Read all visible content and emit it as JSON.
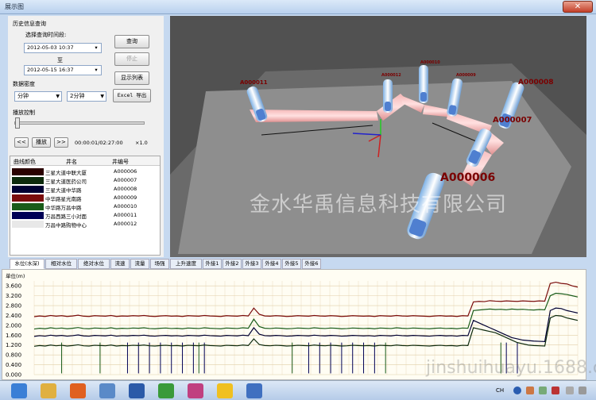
{
  "window": {
    "title": "展示图",
    "close": "✕"
  },
  "query": {
    "group_label": "历史信息查询",
    "time_range_label": "选择查询时间段:",
    "start": "2012-05-03 10:37",
    "to_label": "至",
    "end": "2012-05-15 16:37",
    "density_label": "数据密度",
    "density_unit": "分钟",
    "density_value": "2分钟",
    "query_button": "查询",
    "stop_button": "停止",
    "list_button": "显示列表",
    "excel_button": "Excel 导出"
  },
  "playback": {
    "label": "播放控制",
    "back_button": "<<",
    "play_button": "播放",
    "forward_button": ">>",
    "time": "00:00:01/02:27:00",
    "speed": "×1.0",
    "progress": 0.0
  },
  "legend": {
    "headers": [
      "曲线颜色",
      "井名",
      "井编号"
    ],
    "rows": [
      {
        "color": "#2a0000",
        "name": "三星大道中联大厦",
        "id": "A000006"
      },
      {
        "color": "#0d2a0d",
        "name": "三星大道医药公司",
        "id": "A000007"
      },
      {
        "color": "#000033",
        "name": "三星大道中华路",
        "id": "A000008"
      },
      {
        "color": "#7a0c0c",
        "name": "中华路星光南路",
        "id": "A000009"
      },
      {
        "color": "#1a5c1a",
        "name": "中华路万昌中路",
        "id": "A000010"
      },
      {
        "color": "#000055",
        "name": "万昌西路三小对面",
        "id": "A000011"
      },
      {
        "color": "#e8e8e8",
        "name": "万昌中路购物中心",
        "id": "A000012"
      }
    ]
  },
  "view3d": {
    "wells": [
      "A000011",
      "A000012",
      "A000010",
      "A000009",
      "A000008",
      "A000007",
      "A000006"
    ]
  },
  "tabs": [
    "水位(水深)",
    "相对水位",
    "绝对水位",
    "流速",
    "流量",
    "场强",
    "上升速度",
    "外接1",
    "外接2",
    "外接3",
    "外接4",
    "外接5",
    "外接6"
  ],
  "chart_data": {
    "type": "line",
    "ylabel": "单位(m)",
    "y_ticks": [
      "3.600",
      "3.200",
      "2.800",
      "2.400",
      "2.000",
      "1.600",
      "1.200",
      "0.800",
      "0.400",
      "0.000"
    ],
    "ylim": [
      0,
      3.8
    ],
    "x_count": 100,
    "series": [
      {
        "color": "#7a0c0c",
        "values": [
          2.35,
          2.38,
          2.36,
          2.4,
          2.37,
          2.39,
          2.36,
          2.38,
          2.41,
          2.37,
          2.36,
          2.39,
          2.38,
          2.37,
          2.4,
          2.36,
          2.38,
          2.37,
          2.39,
          2.38,
          2.4,
          2.37,
          2.36,
          2.38,
          2.39,
          2.37,
          2.38,
          2.36,
          2.39,
          2.38,
          2.37,
          2.4,
          2.38,
          2.37,
          2.36,
          2.39,
          2.38,
          2.37,
          2.4,
          2.38,
          2.7,
          2.45,
          2.38,
          2.37,
          2.39,
          2.38,
          2.36,
          2.37,
          2.39,
          2.38,
          2.37,
          2.4,
          2.38,
          2.37,
          2.39,
          2.38,
          2.36,
          2.37,
          2.39,
          2.38,
          2.37,
          2.38,
          2.36,
          2.39,
          2.38,
          2.37,
          2.4,
          2.38,
          2.37,
          2.39,
          2.38,
          2.37,
          2.36,
          2.38,
          2.39,
          2.37,
          2.38,
          2.36,
          2.39,
          2.38,
          2.95,
          2.97,
          2.96,
          3.0,
          2.98,
          2.97,
          2.99,
          2.98,
          2.97,
          2.99,
          2.98,
          2.97,
          2.99,
          2.98,
          3.7,
          3.75,
          3.7,
          3.68,
          3.6,
          3.55
        ]
      },
      {
        "color": "#1a5c1a",
        "values": [
          1.85,
          1.88,
          1.86,
          1.9,
          1.87,
          1.89,
          1.86,
          1.88,
          1.91,
          1.87,
          1.86,
          1.89,
          1.88,
          1.87,
          1.9,
          1.86,
          1.88,
          1.87,
          1.89,
          1.88,
          1.9,
          1.87,
          1.86,
          1.88,
          1.89,
          1.87,
          1.88,
          1.86,
          1.89,
          1.88,
          1.87,
          1.9,
          1.88,
          1.87,
          1.86,
          1.89,
          1.88,
          1.87,
          1.9,
          1.88,
          2.25,
          1.95,
          1.88,
          1.87,
          1.89,
          1.88,
          1.86,
          1.87,
          1.89,
          1.88,
          1.87,
          1.9,
          1.88,
          1.87,
          1.89,
          1.88,
          1.86,
          1.87,
          1.89,
          1.88,
          1.87,
          1.88,
          1.86,
          1.89,
          1.88,
          1.87,
          1.9,
          1.88,
          1.87,
          1.89,
          1.88,
          1.87,
          1.86,
          1.88,
          1.89,
          1.87,
          1.88,
          1.86,
          1.89,
          1.88,
          2.6,
          2.62,
          2.64,
          2.66,
          2.64,
          2.65,
          2.63,
          2.66,
          2.64,
          2.65,
          2.63,
          2.62,
          2.64,
          2.63,
          3.2,
          3.3,
          3.28,
          3.25,
          3.2,
          3.15
        ]
      },
      {
        "color": "#000033",
        "values": [
          1.55,
          1.58,
          1.56,
          1.6,
          1.57,
          1.59,
          1.56,
          1.58,
          1.61,
          1.57,
          1.56,
          1.59,
          1.58,
          1.57,
          1.6,
          1.56,
          1.58,
          1.57,
          1.59,
          1.58,
          1.6,
          1.57,
          1.56,
          1.58,
          1.59,
          1.57,
          1.58,
          1.56,
          1.59,
          1.58,
          1.57,
          1.6,
          1.58,
          1.57,
          1.56,
          1.59,
          1.58,
          1.57,
          1.6,
          1.58,
          1.9,
          1.64,
          1.58,
          1.57,
          1.59,
          1.58,
          1.56,
          1.57,
          1.59,
          1.58,
          1.57,
          1.6,
          1.58,
          1.57,
          1.59,
          1.58,
          1.56,
          1.57,
          1.59,
          1.58,
          1.57,
          1.58,
          1.56,
          1.59,
          1.58,
          1.57,
          1.6,
          1.58,
          1.57,
          1.59,
          1.58,
          1.57,
          1.56,
          1.58,
          1.59,
          1.57,
          1.58,
          1.56,
          1.59,
          1.58,
          2.2,
          2.1,
          2.0,
          1.9,
          1.8,
          1.7,
          1.6,
          1.5,
          1.45,
          1.4,
          1.38,
          1.36,
          1.35,
          1.34,
          2.6,
          2.7,
          2.68,
          2.6,
          2.55,
          2.5
        ]
      },
      {
        "color": "#0d2a0d",
        "values": [
          1.15,
          1.18,
          1.16,
          1.2,
          1.17,
          1.19,
          1.16,
          1.18,
          1.21,
          1.17,
          1.16,
          1.19,
          1.18,
          1.17,
          1.2,
          1.16,
          1.18,
          1.17,
          1.19,
          1.18,
          1.2,
          1.17,
          1.16,
          1.18,
          1.19,
          1.17,
          1.18,
          1.16,
          1.19,
          1.18,
          1.17,
          1.2,
          1.18,
          1.17,
          1.16,
          1.19,
          1.18,
          1.17,
          1.2,
          1.18,
          1.45,
          1.22,
          1.18,
          1.17,
          1.19,
          1.18,
          1.16,
          1.17,
          1.19,
          1.18,
          1.17,
          1.2,
          1.18,
          1.17,
          1.19,
          1.18,
          1.16,
          1.17,
          1.19,
          1.18,
          1.17,
          1.18,
          1.16,
          1.19,
          1.18,
          1.17,
          1.2,
          1.18,
          1.17,
          1.19,
          1.18,
          1.17,
          1.16,
          1.18,
          1.19,
          1.17,
          1.18,
          1.16,
          1.19,
          1.18,
          1.9,
          1.85,
          1.8,
          1.75,
          1.7,
          1.6,
          1.5,
          1.4,
          1.3,
          1.25,
          1.2,
          1.18,
          1.17,
          1.16,
          2.3,
          2.4,
          2.38,
          2.3,
          2.25,
          2.2
        ]
      }
    ],
    "spikes": [
      {
        "color": "#000055",
        "x": [
          17,
          19,
          21,
          23,
          25,
          27,
          29,
          31,
          50,
          52,
          54,
          56,
          58,
          60,
          62,
          86,
          88
        ]
      },
      {
        "color": "#1a5c1a",
        "x": [
          5,
          12,
          30,
          47,
          64,
          85
        ]
      }
    ]
  },
  "taskbar": {
    "apps": [
      "start-icon",
      "folder-icon",
      "media-player-icon",
      "computer-icon",
      "word-icon",
      "image-viewer-icon",
      "browser-icon",
      "note-icon",
      "app-icon"
    ],
    "tray": "CH"
  },
  "watermark": {
    "company": "金水华禹信息科技有限公司",
    "site": "jinshuihuayu.1688.com"
  }
}
